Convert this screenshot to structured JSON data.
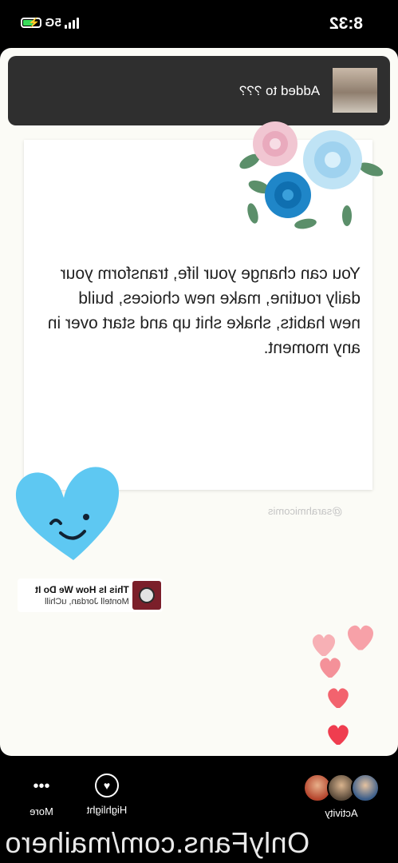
{
  "status_bar": {
    "time": "8:32",
    "network": "5G"
  },
  "toast": {
    "text": "Added to ???"
  },
  "story": {
    "quote": "You can change your life, transform your daily routine, make new choices, build new habits, shake shit up and start over in any moment.",
    "handle": "@sarahmicomis"
  },
  "music": {
    "title": "This Is How We Do It",
    "artist": "Montell Jordan, uChill"
  },
  "bottom_bar": {
    "activity_label": "Activity",
    "highlight_label": "Highlight",
    "more_label": "More"
  },
  "watermark": "OnlyFans.com/maihero",
  "colors": {
    "background": "#000000",
    "story_bg": "#fbfbf6",
    "toast_bg": "#2f2f2f",
    "heart_blue": "#5ec8f2",
    "heart_pink": "#f27c88"
  },
  "icons": [
    "battery-icon",
    "signal-icon",
    "heart-sticker",
    "flowers-sticker",
    "highlight-heart-icon",
    "more-dots-icon"
  ]
}
